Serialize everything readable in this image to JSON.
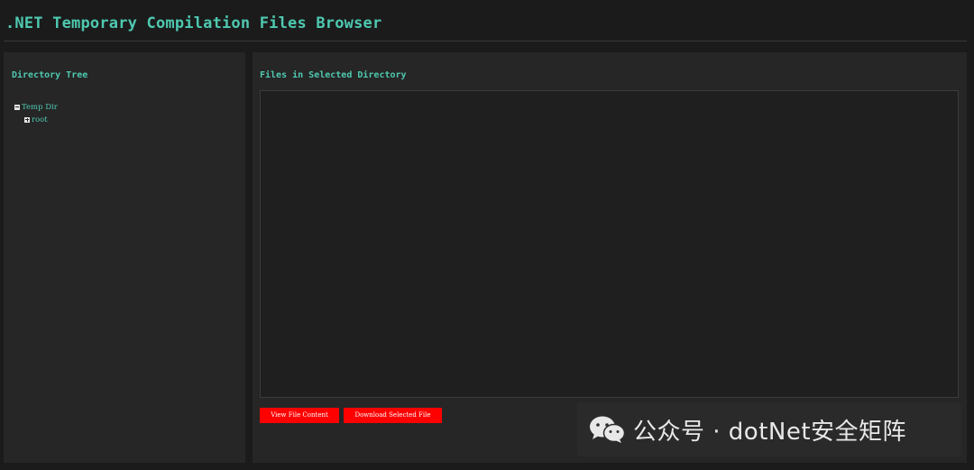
{
  "header": {
    "title": ".NET Temporary Compilation Files Browser"
  },
  "tree_panel": {
    "heading": "Directory Tree",
    "nodes": [
      {
        "label": "Temp Dir",
        "state": "expanded",
        "icon": "minus-box-icon"
      },
      {
        "label": "root",
        "state": "collapsed",
        "icon": "plus-box-icon"
      }
    ]
  },
  "files_panel": {
    "heading": "Files in Selected Directory",
    "view_button": "View File Content",
    "download_button": "Download Selected File"
  },
  "watermark": {
    "text": "公众号 · dotNet安全矩阵",
    "icon": "wechat-logo"
  },
  "colors": {
    "accent": "#4ec9b0",
    "button": "#ff0000",
    "background": "#1b1b1b",
    "panel": "#262626"
  }
}
